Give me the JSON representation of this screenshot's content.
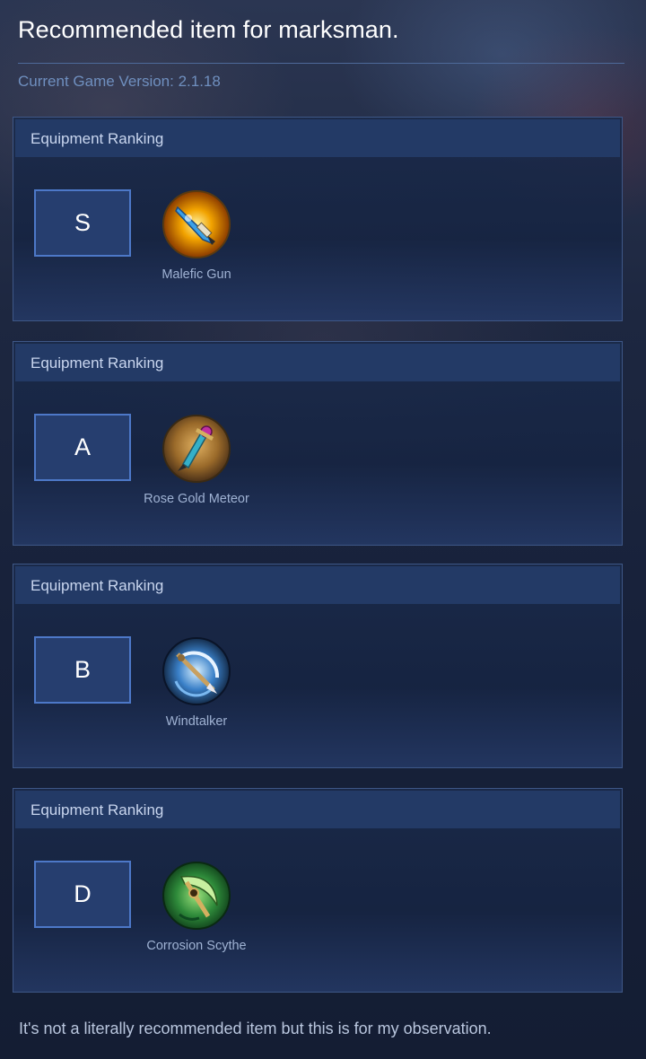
{
  "page": {
    "title": "Recommended item for marksman.",
    "version_label": "Current Game Version: 2.1.18",
    "footer_note": "It's not a literally recommended item but this is for my observation."
  },
  "sections": [
    {
      "header": "Equipment Ranking",
      "rank": "S",
      "item": {
        "name": "Malefic Gun",
        "icon": "malefic-gun-icon"
      }
    },
    {
      "header": "Equipment Ranking",
      "rank": "A",
      "item": {
        "name": "Rose Gold Meteor",
        "icon": "rose-gold-meteor-icon"
      }
    },
    {
      "header": "Equipment Ranking",
      "rank": "B",
      "item": {
        "name": "Windtalker",
        "icon": "windtalker-icon"
      }
    },
    {
      "header": "Equipment Ranking",
      "rank": "D",
      "item": {
        "name": "Corrosion Scythe",
        "icon": "corrosion-scythe-icon"
      }
    }
  ],
  "colors": {
    "background": "#17223d",
    "card_border": "#3e5787",
    "card_header": "#233a66",
    "rank_box_border": "#4d78c8",
    "rank_box_fill": "#263e6f",
    "version_text": "#6f8fbf",
    "item_text": "#9fb2d3"
  }
}
